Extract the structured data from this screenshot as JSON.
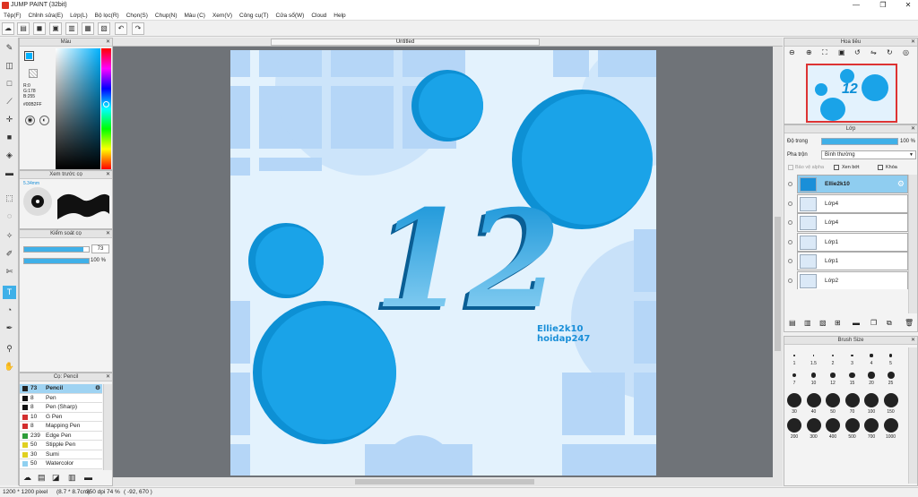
{
  "window": {
    "title": "JUMP PAINT (32bit)",
    "min": "—",
    "max": "❐",
    "close": "✕"
  },
  "menu": [
    "Tệp(F)",
    "Chỉnh sửa(E)",
    "Lớp(L)",
    "Bộ lọc(R)",
    "Chọn(S)",
    "Chup(N)",
    "Màu (C)",
    "Xem(V)",
    "Công cụ(T)",
    "Cửa sổ(W)",
    "Cloud",
    "Help"
  ],
  "doc_tab": "Untitled",
  "color_panel": {
    "title": "Màu",
    "r": "R:0",
    "g": "G:178",
    "b": "B:255",
    "hex": "#00B2FF",
    "accent": "#00b2ff"
  },
  "preview_panel": {
    "title": "Xem trước cọ",
    "size": "5.34mm"
  },
  "brush_control": {
    "title": "Kiểm soát cọ",
    "size_value": "73",
    "opacity_value": "100 %",
    "size_fill": 0.91,
    "opacity_fill": 1.0
  },
  "brush_list": {
    "title": "Cọ: Pencil",
    "items": [
      {
        "size": "73",
        "name": "Pencil",
        "color": "#222222"
      },
      {
        "size": "8",
        "name": "Pen",
        "color": "#111111"
      },
      {
        "size": "8",
        "name": "Pen (Sharp)",
        "color": "#111111"
      },
      {
        "size": "10",
        "name": "G Pen",
        "color": "#d32f2f"
      },
      {
        "size": "8",
        "name": "Mapping Pen",
        "color": "#d32f2f"
      },
      {
        "size": "239",
        "name": "Edge Pen",
        "color": "#2e9e3a"
      },
      {
        "size": "50",
        "name": "Stipple Pen",
        "color": "#e0d020"
      },
      {
        "size": "30",
        "name": "Sumi",
        "color": "#e0d020"
      },
      {
        "size": "50",
        "name": "Watercolor",
        "color": "#8fd0f0"
      }
    ]
  },
  "navigator": {
    "title": "Hoa tiêu"
  },
  "layers": {
    "title": "Lớp",
    "opacity_label": "Độ trong",
    "opacity_value": "100 %",
    "blend_label": "Pha trộn",
    "blend_value": "Bình thường",
    "protect_alpha": "Bảo vệ alpha",
    "clipping": "Xen bớt",
    "lock": "Khóa",
    "items": [
      "Ellie2k10",
      "Lớp4",
      "Lớp4",
      "Lớp1",
      "Lớp1",
      "Lớp2"
    ]
  },
  "brush_size": {
    "title": "Brush Size",
    "labels": [
      "1",
      "1.5",
      "2",
      "3",
      "4",
      "5",
      "7",
      "10",
      "12",
      "15",
      "20",
      "25",
      "30",
      "40",
      "50",
      "70",
      "100",
      "150",
      "200",
      "300",
      "400",
      "500",
      "700",
      "1000"
    ]
  },
  "artwork": {
    "number": "12",
    "line1": "Ellie2k10",
    "line2": "hoidap247",
    "blue": "#1aa3e8"
  },
  "status": {
    "pixels": "1200 * 1200 pixel",
    "size": "(8.7 * 8.7cm)",
    "dpi": "350 dpi",
    "zoom": "74 %",
    "coords": "( -92, 670 )"
  }
}
